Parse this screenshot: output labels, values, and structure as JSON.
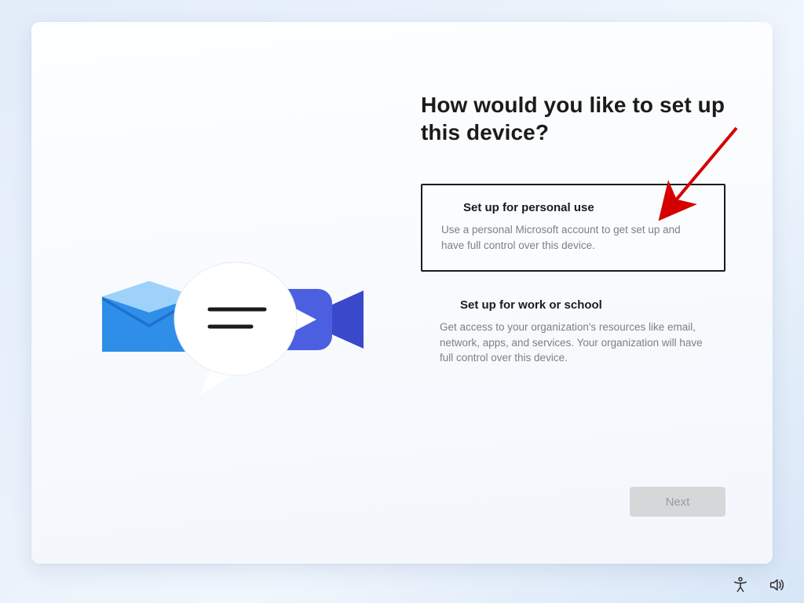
{
  "heading": "How would you like to set up this device?",
  "options": {
    "personal": {
      "title": "Set up for personal use",
      "desc": "Use a personal Microsoft account to get set up and have full control over this device."
    },
    "work": {
      "title": "Set up for work or school",
      "desc": "Get access to your organization's resources like email, network, apps, and services. Your organization will have full control over this device."
    }
  },
  "next_label": "Next",
  "colors": {
    "arrow": "#d40000",
    "accent_blue_1": "#2f6fe0",
    "accent_blue_2": "#4b5fe0",
    "text_dark": "#1b1b1b",
    "text_muted": "#7d7f82"
  }
}
